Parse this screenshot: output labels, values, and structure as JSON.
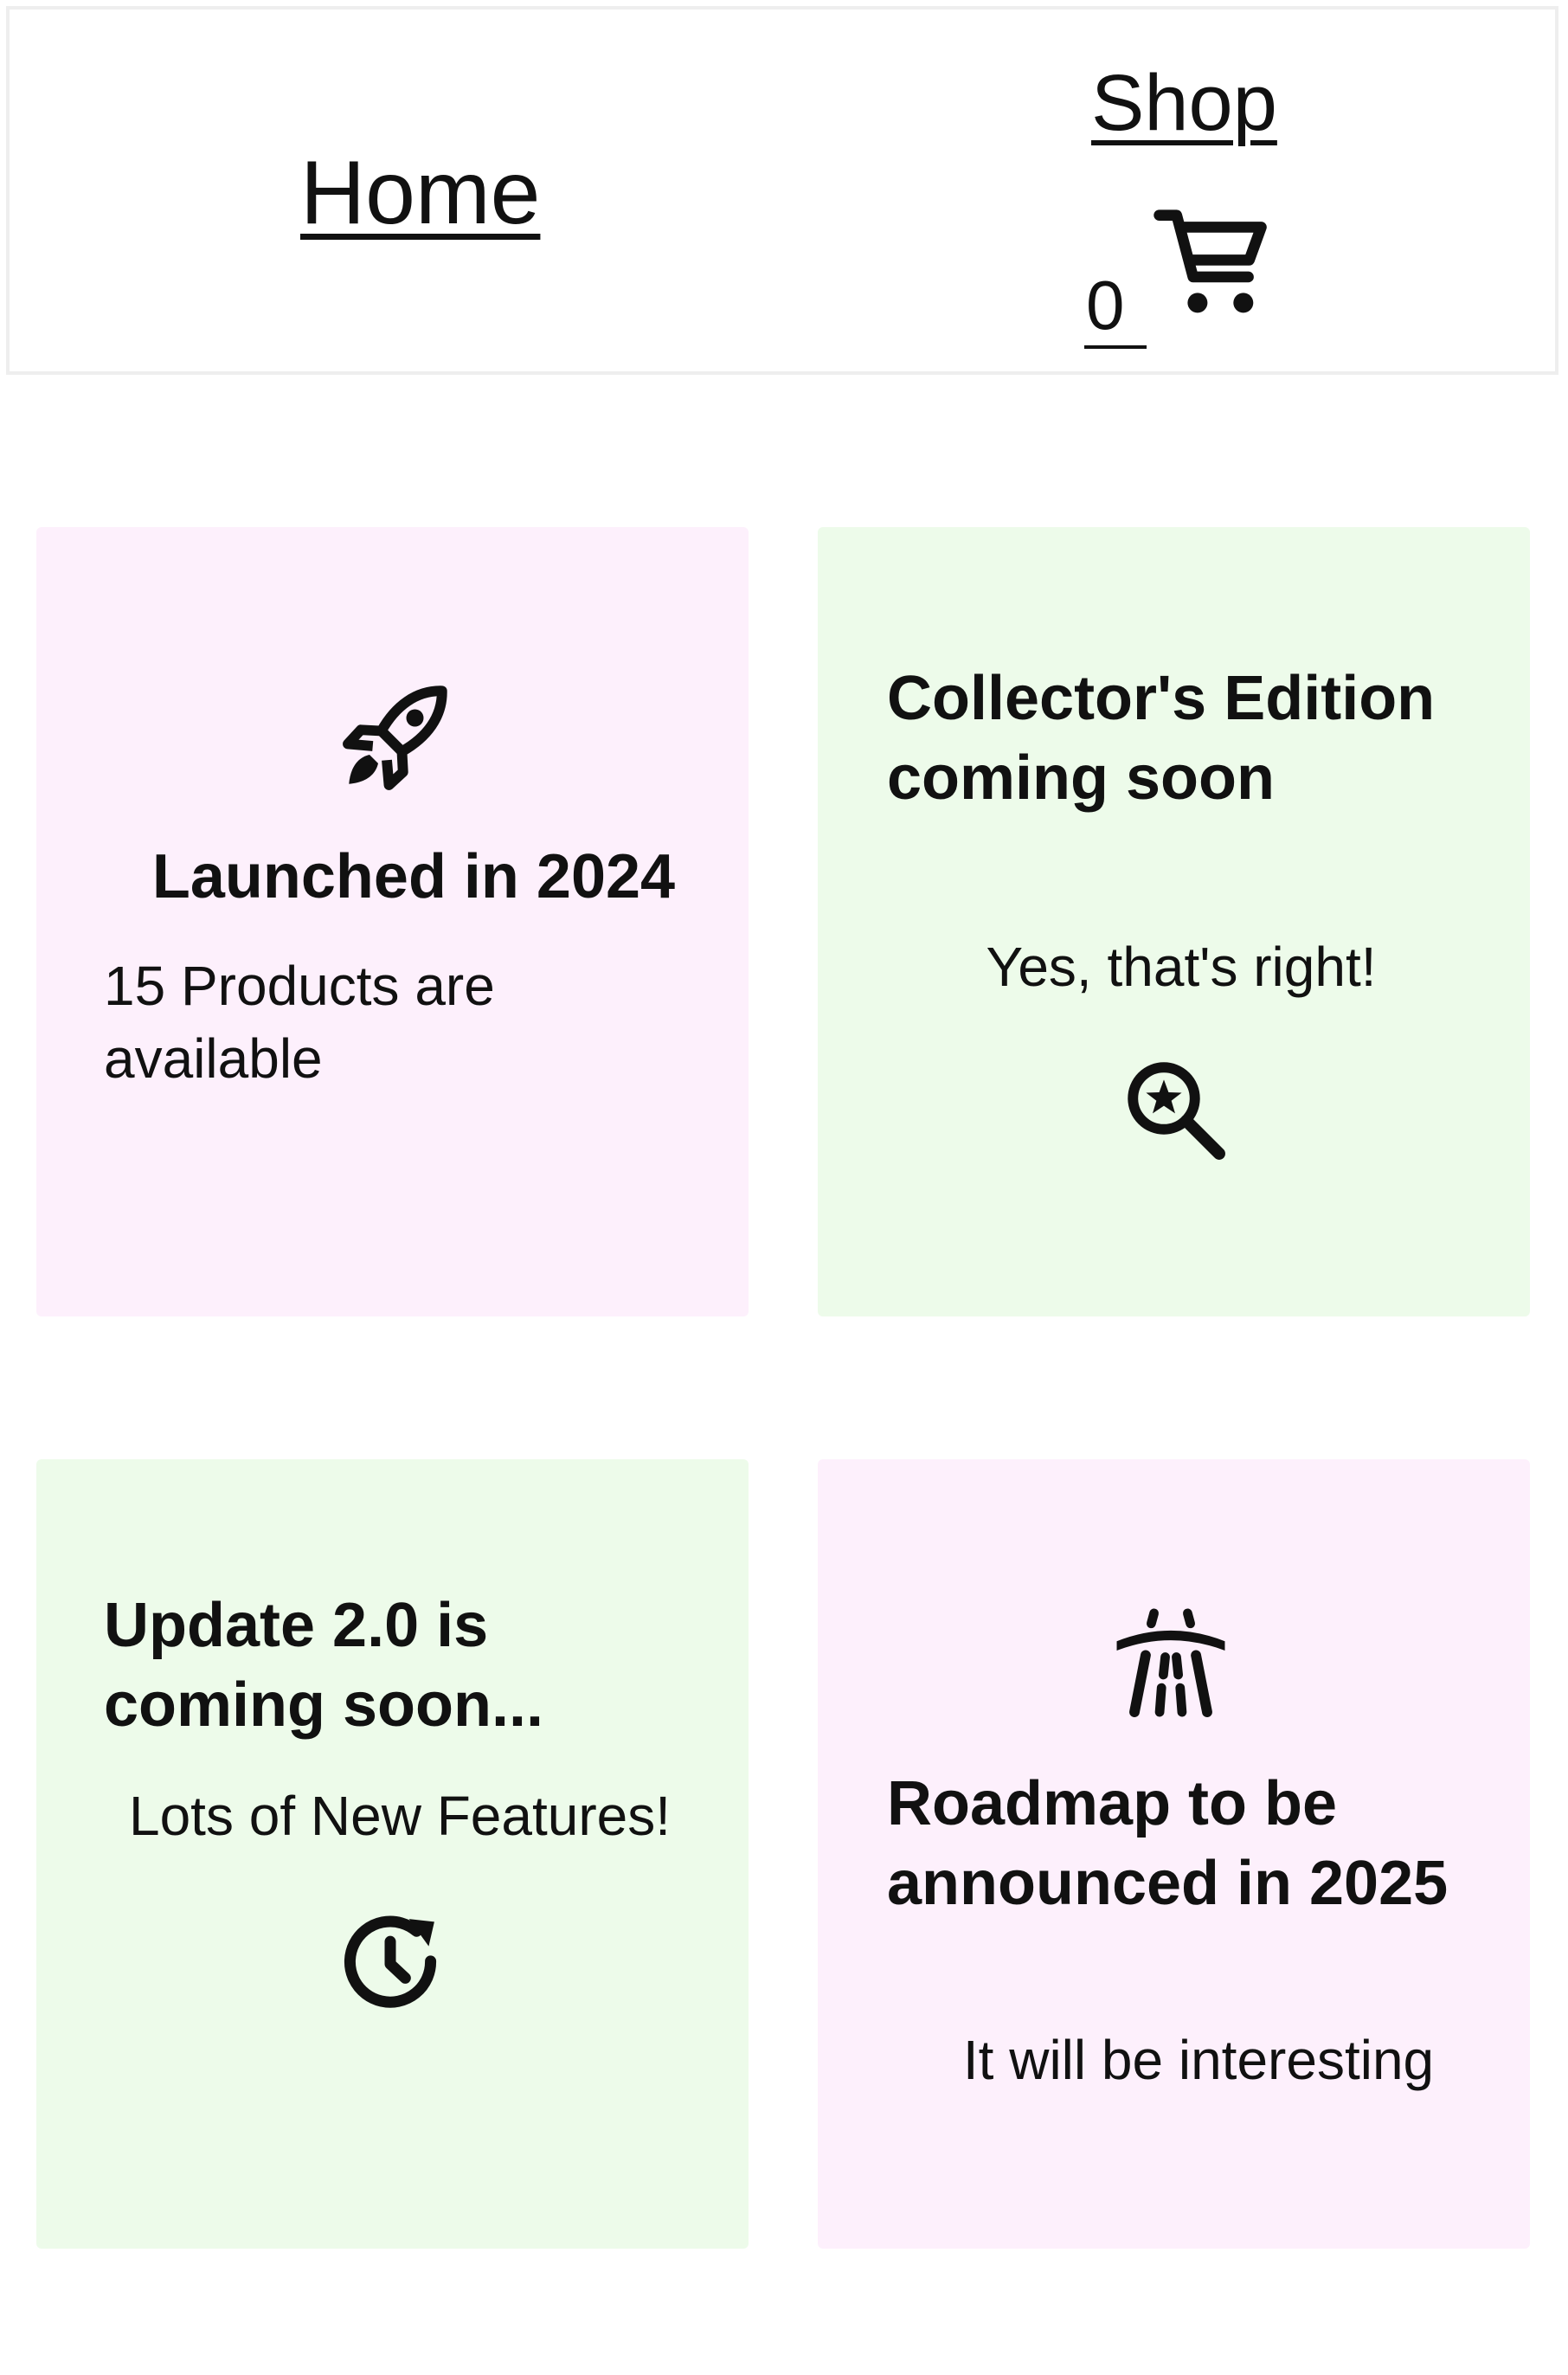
{
  "nav": {
    "home_label": "Home",
    "shop_label": "Shop",
    "cart_count": "0"
  },
  "cards": [
    {
      "title": "Launched in 2024",
      "text": "15 Products are available",
      "icon": "rocket-icon",
      "background": "#fdf0fc"
    },
    {
      "title": "Collector's Edition coming soon",
      "text": "Yes, that's right!",
      "icon": "search-star-icon",
      "background": "#edfbea"
    },
    {
      "title": "Update 2.0 is coming soon...",
      "text": "Lots of New Features!",
      "icon": "update-clock-icon",
      "background": "#edfbea"
    },
    {
      "title": "Roadmap to be announced in 2025",
      "text": "It will be interesting",
      "icon": "road-icon",
      "background": "#fdf0fc"
    }
  ],
  "colors": {
    "pink_card": "#fdf0fc",
    "green_card": "#edfbea",
    "text": "#111111"
  }
}
